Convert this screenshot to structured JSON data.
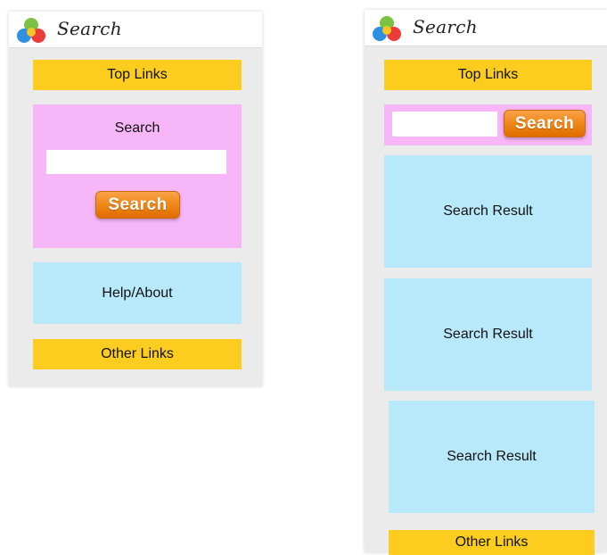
{
  "left_screen": {
    "title": "Search",
    "top_links": "Top Links",
    "search_panel": {
      "label": "Search",
      "input_value": "",
      "button_label": "Search"
    },
    "help_about": "Help/About",
    "other_links": "Other Links"
  },
  "right_screen": {
    "title": "Search",
    "top_links": "Top Links",
    "search_bar": {
      "input_value": "",
      "button_label": "Search"
    },
    "results": [
      {
        "label": "Search Result"
      },
      {
        "label": "Search Result"
      },
      {
        "label": "Search Result"
      }
    ],
    "other_links": "Other Links"
  },
  "colors": {
    "yellow_block": "#fccd1e",
    "pink_block": "#f6b6f7",
    "cyan_block": "#b8e9fb",
    "orange_button": "#f08a1a",
    "frame_gray": "#ebebeb"
  },
  "icons": {
    "logo": "multicolor-ball-logo-icon"
  }
}
